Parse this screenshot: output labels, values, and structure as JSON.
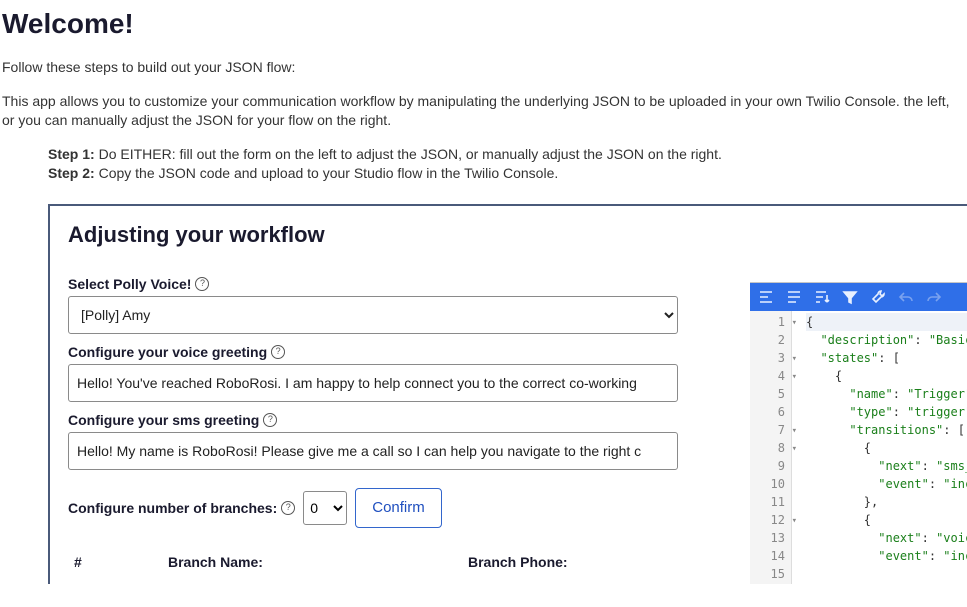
{
  "header": {
    "title": "Welcome!"
  },
  "intro": {
    "line1": "Follow these steps to build out your JSON flow:",
    "line2": "This app allows you to customize your communication workflow by manipulating the underlying JSON to be uploaded in your own Twilio Console. the left, or you can manually adjust the JSON for your flow on the right."
  },
  "steps": {
    "s1_label": "Step 1:",
    "s1_text": " Do EITHER: fill out the form on the left to adjust the JSON, or manually adjust the JSON on the right.",
    "s2_label": "Step 2:",
    "s2_text": " Copy the JSON code and upload to your Studio flow in the Twilio Console."
  },
  "form": {
    "title": "Adjusting your workflow",
    "voice_label": "Select Polly Voice!",
    "voice_value": "[Polly] Amy",
    "greeting_voice_label": "Configure your voice greeting",
    "greeting_voice_value": "Hello! You've reached RoboRosi. I am happy to help connect you to the correct co-working",
    "greeting_sms_label": "Configure your sms greeting",
    "greeting_sms_value": "Hello! My name is RoboRosi! Please give me a call so I can help you navigate to the right c",
    "branches_label": "Configure number of branches:",
    "branches_value": "0",
    "confirm_label": "Confirm",
    "table": {
      "col_idx": "#",
      "col_name": "Branch Name:",
      "col_phone": "Branch Phone:"
    }
  },
  "editor": {
    "gutter": [
      "1",
      "2",
      "3",
      "4",
      "5",
      "6",
      "7",
      "8",
      "9",
      "10",
      "11",
      "12",
      "13",
      "14",
      "15"
    ],
    "fold_lines": [
      1,
      3,
      4,
      7,
      8,
      12
    ],
    "code_lines": [
      [
        [
          "brace",
          "{"
        ]
      ],
      [
        [
          "pad",
          "  "
        ],
        [
          "key",
          "\"description\""
        ],
        [
          "punc",
          ": "
        ],
        [
          "str",
          "\"Basic"
        ]
      ],
      [
        [
          "pad",
          "  "
        ],
        [
          "key",
          "\"states\""
        ],
        [
          "punc",
          ": ["
        ]
      ],
      [
        [
          "pad",
          "    "
        ],
        [
          "brace",
          "{"
        ]
      ],
      [
        [
          "pad",
          "      "
        ],
        [
          "key",
          "\"name\""
        ],
        [
          "punc",
          ": "
        ],
        [
          "str",
          "\"Trigger\""
        ],
        [
          "punc",
          ","
        ]
      ],
      [
        [
          "pad",
          "      "
        ],
        [
          "key",
          "\"type\""
        ],
        [
          "punc",
          ": "
        ],
        [
          "str",
          "\"trigger\""
        ],
        [
          "punc",
          ","
        ]
      ],
      [
        [
          "pad",
          "      "
        ],
        [
          "key",
          "\"transitions\""
        ],
        [
          "punc",
          ": ["
        ]
      ],
      [
        [
          "pad",
          "        "
        ],
        [
          "brace",
          "{"
        ]
      ],
      [
        [
          "pad",
          "          "
        ],
        [
          "key",
          "\"next\""
        ],
        [
          "punc",
          ": "
        ],
        [
          "str",
          "\"sms_g"
        ]
      ],
      [
        [
          "pad",
          "          "
        ],
        [
          "key",
          "\"event\""
        ],
        [
          "punc",
          ": "
        ],
        [
          "str",
          "\"inco"
        ]
      ],
      [
        [
          "pad",
          "        "
        ],
        [
          "brace",
          "}"
        ],
        [
          "punc",
          ","
        ]
      ],
      [
        [
          "pad",
          "        "
        ],
        [
          "brace",
          "{"
        ]
      ],
      [
        [
          "pad",
          "          "
        ],
        [
          "key",
          "\"next\""
        ],
        [
          "punc",
          ": "
        ],
        [
          "str",
          "\"voice"
        ]
      ],
      [
        [
          "pad",
          "          "
        ],
        [
          "key",
          "\"event\""
        ],
        [
          "punc",
          ": "
        ],
        [
          "str",
          "\"inco"
        ]
      ],
      [
        [
          "pad",
          ""
        ]
      ]
    ]
  }
}
